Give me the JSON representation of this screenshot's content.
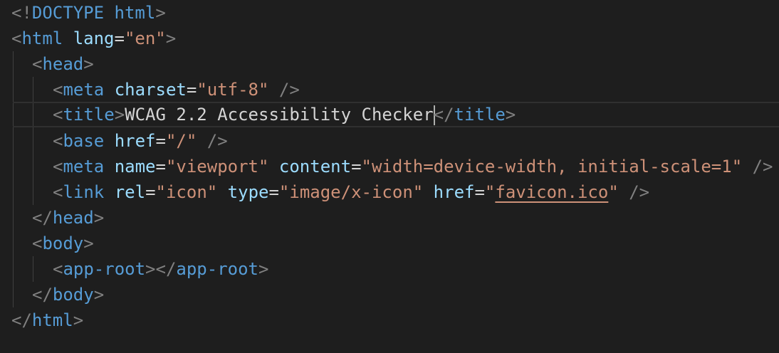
{
  "editor": {
    "language": "html",
    "theme_colors": {
      "background": "#1e1e1e",
      "tag": "#569cd6",
      "punctuation": "#808080",
      "attribute": "#9cdcfe",
      "string": "#ce9178",
      "text": "#d4d4d4"
    },
    "lines": {
      "l1": {
        "open": "<!",
        "tag": "DOCTYPE",
        "sp": " ",
        "word": "html",
        "close": ">"
      },
      "l2": {
        "open": "<",
        "tag": "html",
        "attr": "lang",
        "eq": "=",
        "val": "\"en\"",
        "close": ">"
      },
      "l3": {
        "open": "<",
        "tag": "head",
        "close": ">"
      },
      "l4": {
        "open": "<",
        "tag": "meta",
        "attr": "charset",
        "eq": "=",
        "val": "\"utf-8\"",
        "close": "/>"
      },
      "l5": {
        "open": "<",
        "tag": "title",
        "close": ">",
        "text_before_cursor": "WCAG 2.2 Accessibility Checke",
        "text_after_cursor": "r",
        "end_open": "</",
        "end_tag": "title",
        "end_close": ">"
      },
      "l6": {
        "open": "<",
        "tag": "base",
        "attr": "href",
        "eq": "=",
        "val": "\"/\"",
        "close": "/>"
      },
      "l7": {
        "open": "<",
        "tag": "meta",
        "attr1": "name",
        "val1": "\"viewport\"",
        "attr2": "content",
        "val2": "\"width=device-width, initial-scale=1\"",
        "eq": "=",
        "close": "/>"
      },
      "l8": {
        "open": "<",
        "tag": "link",
        "attr1": "rel",
        "val1": "\"icon\"",
        "attr2": "type",
        "val2": "\"image/x-icon\"",
        "attr3": "href",
        "q": "\"",
        "link": "favicon.ico",
        "eq": "=",
        "close": "/>"
      },
      "l9": {
        "open": "</",
        "tag": "head",
        "close": ">"
      },
      "l10": {
        "open": "<",
        "tag": "body",
        "close": ">"
      },
      "l11": {
        "open": "<",
        "tag": "app-root",
        "close": ">",
        "end_open": "</",
        "end_tag": "app-root",
        "end_close": ">"
      },
      "l12": {
        "open": "</",
        "tag": "body",
        "close": ">"
      },
      "l13": {
        "open": "</",
        "tag": "html",
        "close": ">"
      }
    }
  }
}
